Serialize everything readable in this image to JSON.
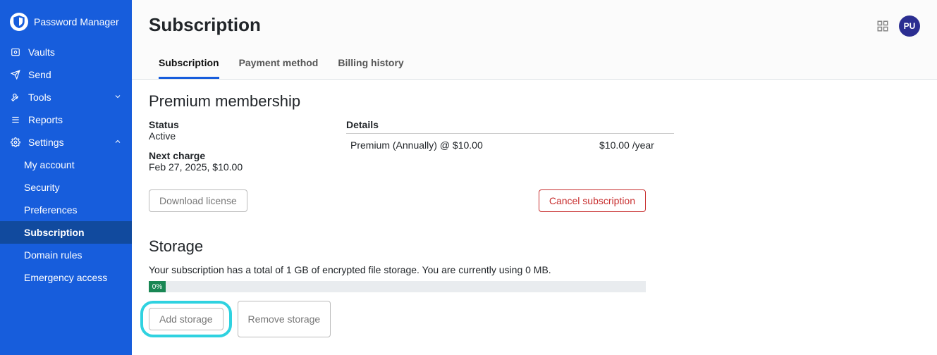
{
  "brand": {
    "name": "Password Manager"
  },
  "sidebar": {
    "items": [
      {
        "label": "Vaults"
      },
      {
        "label": "Send"
      },
      {
        "label": "Tools"
      },
      {
        "label": "Reports"
      },
      {
        "label": "Settings"
      }
    ],
    "settingsChildren": [
      {
        "label": "My account"
      },
      {
        "label": "Security"
      },
      {
        "label": "Preferences"
      },
      {
        "label": "Subscription"
      },
      {
        "label": "Domain rules"
      },
      {
        "label": "Emergency access"
      }
    ]
  },
  "header": {
    "title": "Subscription",
    "avatar": "PU"
  },
  "tabs": [
    {
      "label": "Subscription"
    },
    {
      "label": "Payment method"
    },
    {
      "label": "Billing history"
    }
  ],
  "membership": {
    "heading": "Premium membership",
    "statusLabel": "Status",
    "statusValue": "Active",
    "nextChargeLabel": "Next charge",
    "nextChargeValue": "Feb 27, 2025, $10.00",
    "detailsLabel": "Details",
    "detailsDesc": "Premium (Annually) @ $10.00",
    "detailsPrice": "$10.00 /year",
    "downloadLicense": "Download license",
    "cancelSubscription": "Cancel subscription"
  },
  "storage": {
    "heading": "Storage",
    "desc": "Your subscription has a total of 1 GB of encrypted file storage. You are currently using 0 MB.",
    "percent": "0%",
    "addStorage": "Add storage",
    "removeStorage": "Remove storage"
  }
}
